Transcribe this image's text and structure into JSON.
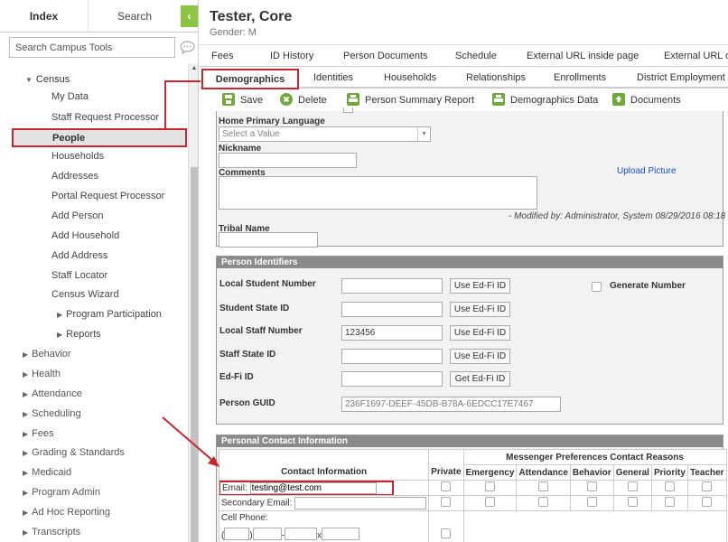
{
  "sidebar": {
    "tabs": {
      "index": "Index",
      "search": "Search"
    },
    "collapse": "‹",
    "search_placeholder": "Search Campus Tools",
    "chat_icon": "chat-bubble-icon",
    "census_label": "Census",
    "census_items": [
      "My Data",
      "Staff Request Processor",
      "People",
      "Households",
      "Addresses",
      "Portal Request Processor",
      "Add Person",
      "Add Household",
      "Add Address",
      "Staff Locator",
      "Census Wizard"
    ],
    "census_subgroups": [
      "Program Participation",
      "Reports"
    ],
    "top_items": [
      "Behavior",
      "Health",
      "Attendance",
      "Scheduling",
      "Fees",
      "Grading & Standards",
      "Medicaid",
      "Program Admin",
      "Ad Hoc Reporting",
      "Transcripts"
    ]
  },
  "header": {
    "name": "Tester, Core",
    "gender": "Gender: M"
  },
  "tabs_row1": [
    "Fees",
    "ID History",
    "Person Documents",
    "Schedule",
    "External URL inside page",
    "External URL o"
  ],
  "tabs_row2": [
    "Demographics",
    "Identities",
    "Households",
    "Relationships",
    "Enrollments",
    "District Employment"
  ],
  "toolbar": {
    "save": "Save",
    "delete": "Delete",
    "summary": "Person Summary Report",
    "demographics_data": "Demographics Data",
    "documents": "Documents"
  },
  "demographics_panel": {
    "home_language_label": "Home Primary Language",
    "home_language_value": "Select a Value",
    "nickname_label": "Nickname",
    "comments_label": "Comments",
    "upload_picture": "Upload Picture",
    "modified_by": "- Modified by: Administrator, System 08/29/2016 08:18",
    "tribal_name_label": "Tribal Name"
  },
  "person_identifiers": {
    "title": "Person Identifiers",
    "local_student_number": "Local Student Number",
    "student_state_id": "Student State ID",
    "local_staff_number": "Local Staff Number",
    "local_staff_number_value": "123456",
    "staff_state_id": "Staff State ID",
    "ed_fi_id": "Ed-Fi ID",
    "person_guid": "Person GUID",
    "person_guid_value": "236F1697-DEEF-45DB-B78A-6EDCC17E7467",
    "use_ed_fi": "Use Ed-Fi ID",
    "get_ed_fi": "Get Ed-Fi ID",
    "generate_number": "Generate Number"
  },
  "contact_info": {
    "title": "Personal Contact Information",
    "messenger_header": "Messenger Preferences Contact Reasons",
    "col_contact": "Contact Information",
    "col_private": "Private",
    "reasons": [
      "Emergency",
      "Attendance",
      "Behavior",
      "General",
      "Priority",
      "Teacher"
    ],
    "email_label": "Email:",
    "email_value": "testing@test.com",
    "secondary_email_label": "Secondary Email:",
    "cell_phone_label": "Cell Phone:",
    "phone_open": "(",
    "phone_close": ")",
    "phone_dash": "-",
    "phone_ext": "x"
  },
  "colors": {
    "accent_green": "#8cc540",
    "highlight_red": "#c8262e",
    "panel_header": "#8a8a8a",
    "link_blue": "#1a4fc4"
  }
}
